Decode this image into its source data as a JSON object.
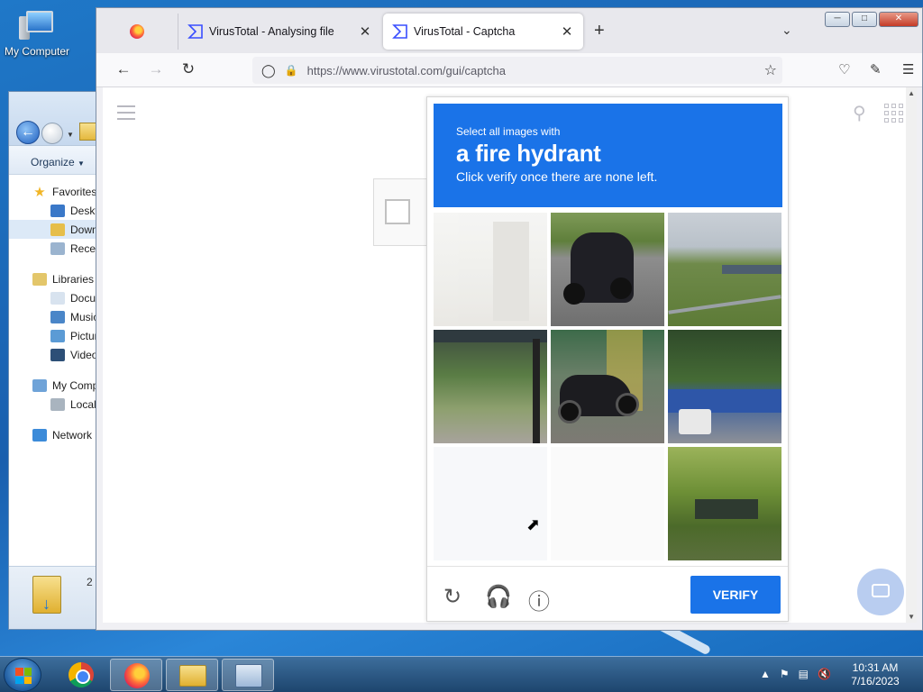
{
  "desktop": {
    "icon_label": "My Computer"
  },
  "explorer": {
    "organize_label": "Organize",
    "nav": [
      {
        "label": "Favorites",
        "icon": "star-icon"
      },
      {
        "label": "Desktop",
        "icon": "desktop-icon"
      },
      {
        "label": "Downloads",
        "icon": "downloads-icon"
      },
      {
        "label": "Recent Places",
        "icon": "recent-icon"
      },
      {
        "label": "Libraries",
        "icon": "libraries-icon"
      },
      {
        "label": "Documents",
        "icon": "documents-icon"
      },
      {
        "label": "Music",
        "icon": "music-icon"
      },
      {
        "label": "Pictures",
        "icon": "pictures-icon"
      },
      {
        "label": "Videos",
        "icon": "videos-icon"
      },
      {
        "label": "My Computer",
        "icon": "computer-icon"
      },
      {
        "label": "Local Disk",
        "icon": "disk-icon"
      },
      {
        "label": "Network",
        "icon": "network-icon"
      }
    ],
    "item_count": "2"
  },
  "browser": {
    "tabs": [
      {
        "title": "",
        "icon": "firefox-icon"
      },
      {
        "title": "VirusTotal - Analysing file",
        "icon": "virustotal-icon"
      },
      {
        "title": "VirusTotal - Captcha",
        "icon": "virustotal-icon"
      }
    ],
    "url": "https://www.virustotal.com/gui/captcha"
  },
  "captcha": {
    "instruction_small": "Select all images with",
    "target": "a fire hydrant",
    "instruction_sub": "Click verify once there are none left.",
    "verify_label": "VERIFY",
    "tiles": [
      {
        "name": "faded-building-wall"
      },
      {
        "name": "motorcycle-rider"
      },
      {
        "name": "field-with-bridge"
      },
      {
        "name": "bus-shelter"
      },
      {
        "name": "parked-scooter"
      },
      {
        "name": "trees-and-cars"
      },
      {
        "name": "faded-blank"
      },
      {
        "name": "faded-blank"
      },
      {
        "name": "green-trees-building"
      }
    ],
    "accent_color": "#1a73e8"
  },
  "taskbar": {
    "time": "10:31 AM",
    "date": "7/16/2023"
  }
}
